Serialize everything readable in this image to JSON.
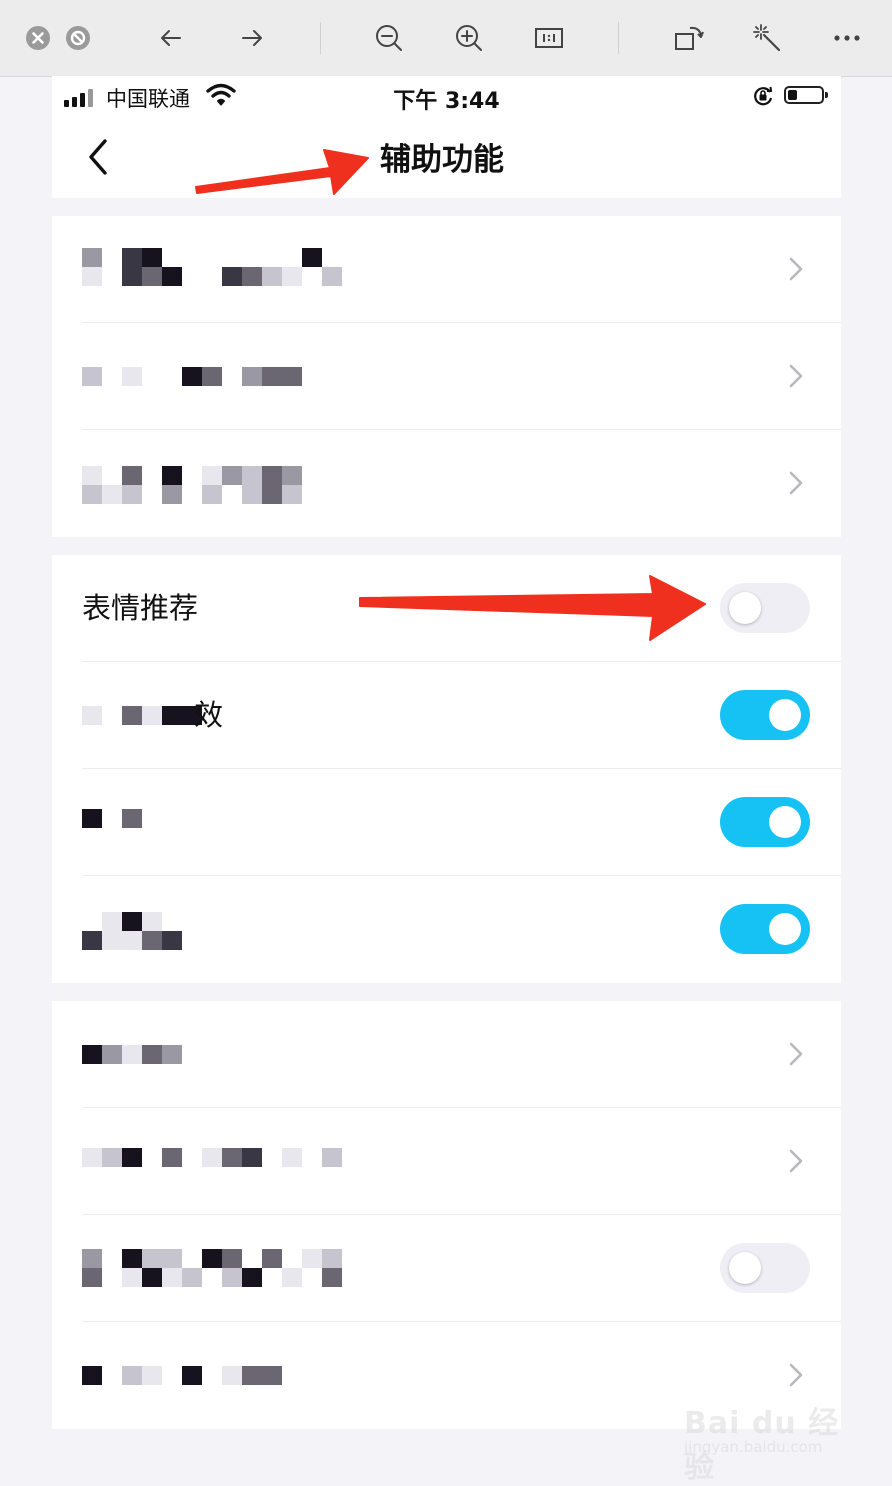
{
  "viewer_toolbar": {
    "icons": [
      "close-circle-icon",
      "block-circle-icon",
      "arrow-left-icon",
      "arrow-right-icon",
      "zoom-out-icon",
      "zoom-in-icon",
      "actual-size-icon",
      "rotate-icon",
      "magic-wand-icon",
      "more-icon"
    ]
  },
  "status_bar": {
    "carrier": "中国联通",
    "time": "下午 3:44"
  },
  "header": {
    "title": "辅助功能"
  },
  "settings": {
    "group1": [
      {
        "type": "chevron"
      },
      {
        "type": "chevron"
      },
      {
        "type": "chevron"
      }
    ],
    "group2": [
      {
        "label": "表情推荐",
        "toggle": "off"
      },
      {
        "label_visible_fragment": "效",
        "toggle": "on"
      },
      {
        "toggle": "on"
      },
      {
        "toggle": "on"
      }
    ],
    "group3": [
      {
        "type": "chevron"
      },
      {
        "type": "chevron"
      },
      {
        "toggle": "off"
      },
      {
        "type": "chevron"
      }
    ]
  },
  "colors": {
    "toggle_on": "#16c2f4",
    "toggle_off": "#eeeef4",
    "annotation_arrow": "#f0301e",
    "background": "#f4f4f8"
  },
  "watermark": {
    "logo": "Bai du 经验",
    "url": "jingyan.baidu.com"
  }
}
